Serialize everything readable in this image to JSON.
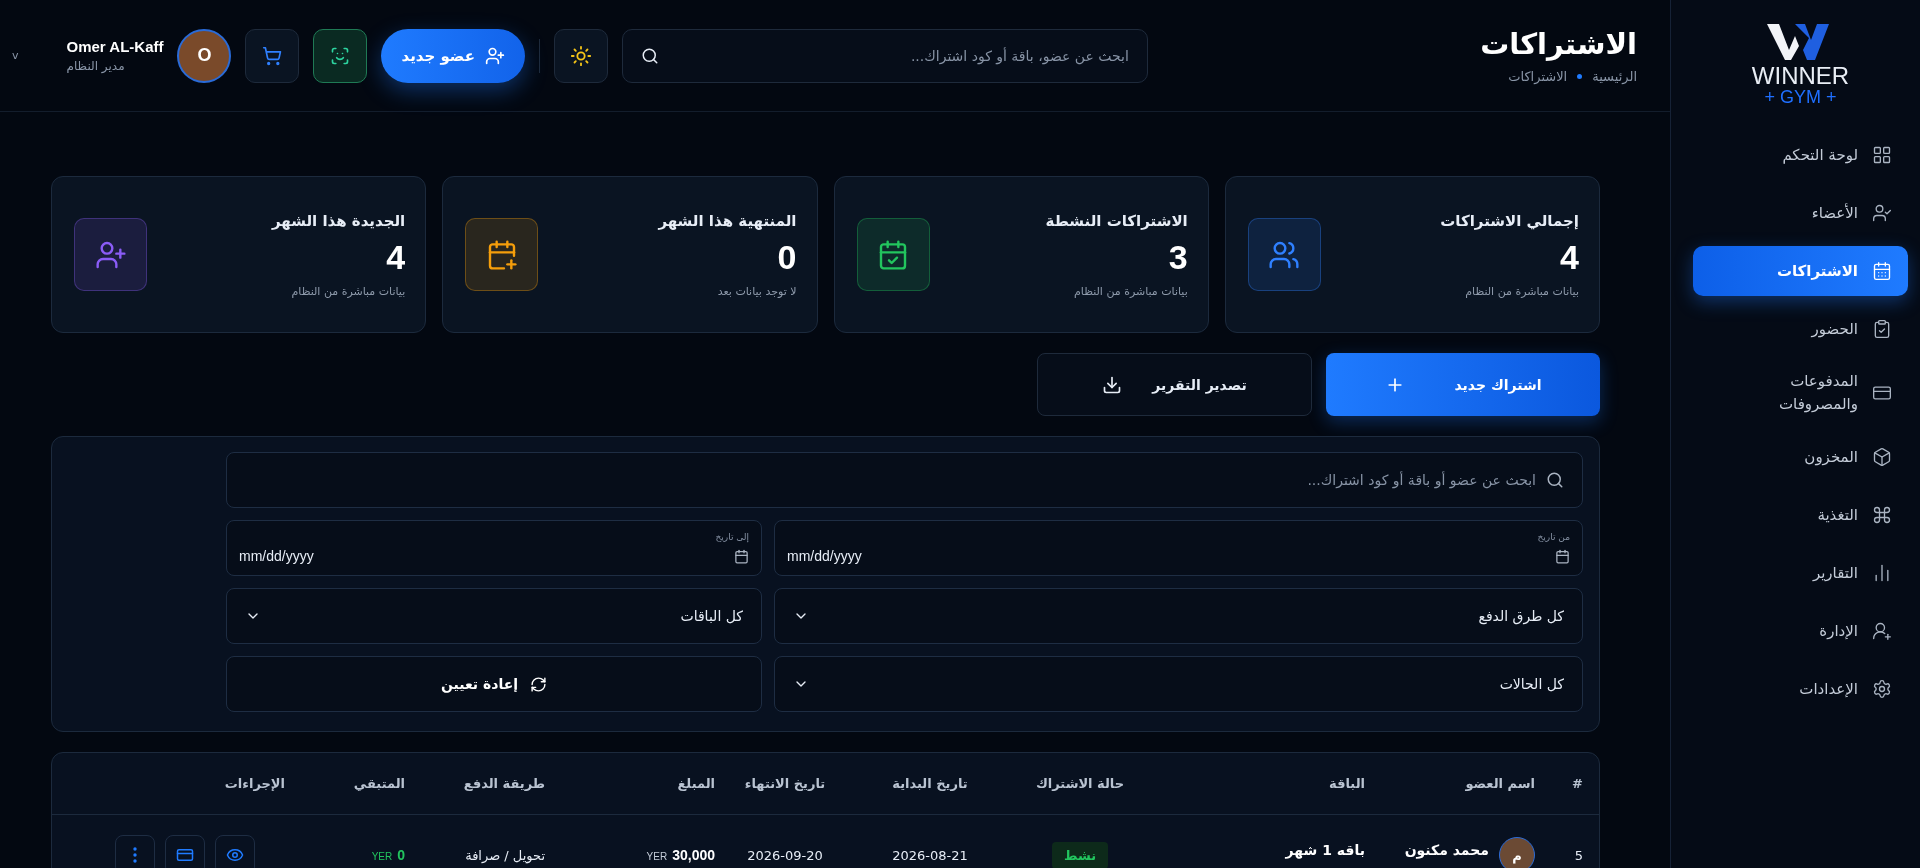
{
  "brand": {
    "name": "WINNER",
    "tagline": "+ GYM +"
  },
  "sidebar": {
    "items": [
      {
        "label": "لوحة التحكم",
        "selected": false
      },
      {
        "label": "الأعضاء",
        "selected": false
      },
      {
        "label": "الاشتراكات",
        "selected": true
      },
      {
        "label": "الحضور",
        "selected": false
      },
      {
        "label": "المدفوعات والمصروفات",
        "selected": false
      },
      {
        "label": "المخزون",
        "selected": false
      },
      {
        "label": "التغذية",
        "selected": false
      },
      {
        "label": "التقارير",
        "selected": false
      },
      {
        "label": "الإدارة",
        "selected": false
      },
      {
        "label": "الإعدادات",
        "selected": false
      }
    ]
  },
  "header": {
    "title": "الاشتراكات",
    "breadcrumb": [
      "الرئيسية",
      "الاشتراكات"
    ],
    "search": {
      "placeholder": "ابحث عن عضو، باقة أو كود اشتراك..."
    },
    "new_member_button": "عضو جديد",
    "user": {
      "name": "Omer AL-Kaff",
      "role": "مدير النظام",
      "initial": "O"
    },
    "menu_caret": "v"
  },
  "stats": [
    {
      "label": "إجمالي الاشتراكات",
      "value": "4",
      "note": "بيانات مباشرة من النظام",
      "color": "#2f80ff"
    },
    {
      "label": "الاشتراكات النشطة",
      "value": "3",
      "note": "بيانات مباشرة من النظام",
      "color": "#22c55e"
    },
    {
      "label": "المنتهية هذا الشهر",
      "value": "0",
      "note": "لا توجد بيانات بعد",
      "color": "#f59e0b"
    },
    {
      "label": "الجديدة هذا الشهر",
      "value": "4",
      "note": "بيانات مباشرة من النظام",
      "color": "#8b5cf6"
    }
  ],
  "actions": {
    "primary": "اشتراك جديد",
    "secondary": "تصدير التقرير"
  },
  "filters": {
    "search": {
      "placeholder": "ابحث عن عضو أو باقة أو كود اشتراك..."
    },
    "dates": [
      {
        "label": "من تاريخ",
        "placeholder": "mm/dd/yyyy"
      },
      {
        "label": "إلى تاريخ",
        "placeholder": "mm/dd/yyyy"
      }
    ],
    "selects": [
      "كل طرق الدفع",
      "كل الباقات",
      "كل الحالات"
    ],
    "reset_button": "إعادة تعيين"
  },
  "table": {
    "columns": [
      "#",
      "اسم العضو",
      "الباقة",
      "حالة الاشتراك",
      "تاريخ البداية",
      "تاريخ الانتهاء",
      "المبلغ",
      "طريقة الدفع",
      "المتبقي",
      "الإجراءات"
    ],
    "rows": [
      {
        "index": "5",
        "initial": "م",
        "name": "محمد مكنون",
        "package": "باقه 1 شهر",
        "status": "نشط",
        "start": "2026-08-21",
        "end": "2026-09-20",
        "amount": "30,000",
        "amount_currency": "YER",
        "method": "تحويل / صرافة",
        "remaining": "0",
        "remaining_currency": "YER"
      }
    ]
  }
}
